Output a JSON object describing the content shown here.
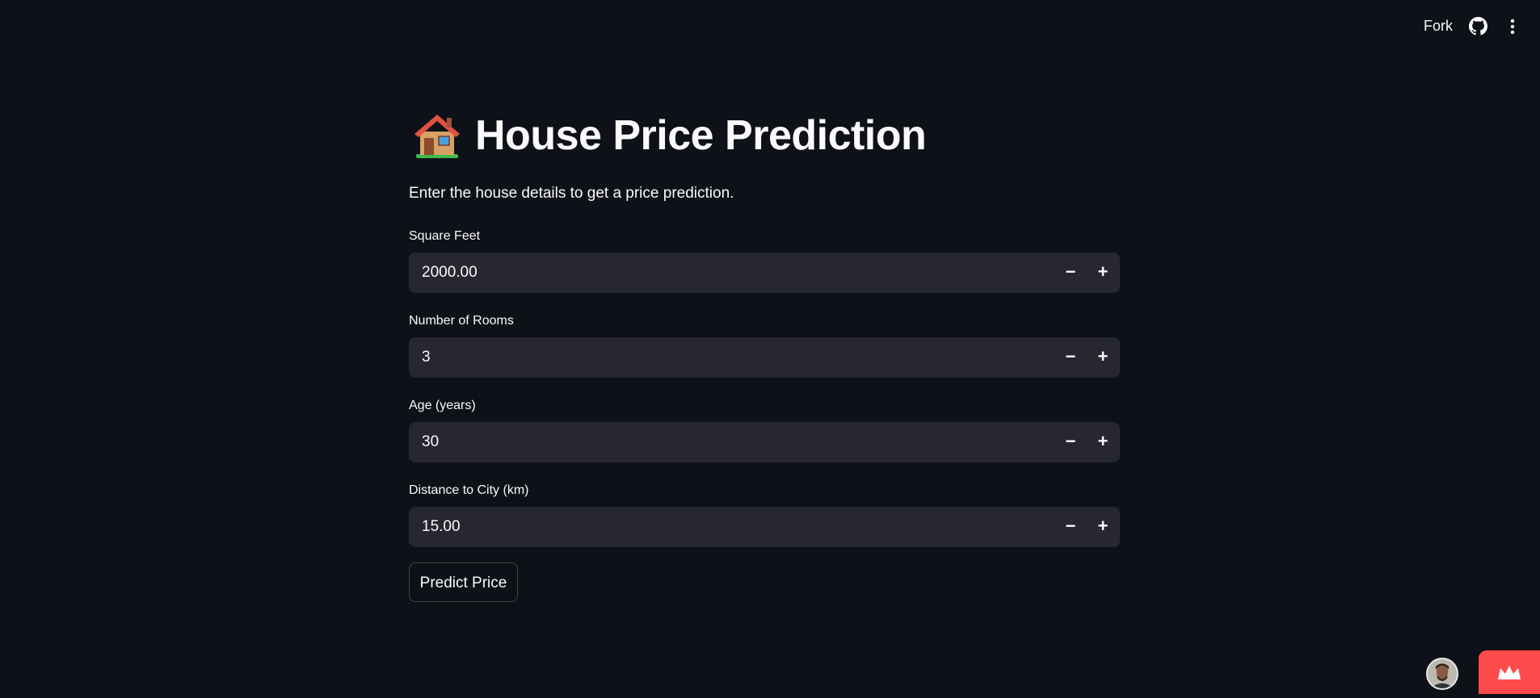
{
  "header": {
    "fork_label": "Fork",
    "icons": [
      "github-icon",
      "more-vertical-icon"
    ]
  },
  "main": {
    "title_icon": "house-icon",
    "title": "House Price Prediction",
    "subtitle": "Enter the house details to get a price prediction.",
    "fields": [
      {
        "label": "Square Feet",
        "value": "2000.00"
      },
      {
        "label": "Number of Rooms",
        "value": "3"
      },
      {
        "label": "Age (years)",
        "value": "30"
      },
      {
        "label": "Distance to City (km)",
        "value": "15.00"
      }
    ],
    "stepper": {
      "minus": "−",
      "plus": "+"
    },
    "predict_button": "Predict Price"
  },
  "footer": {
    "avatar_icon": "user-avatar",
    "badge_icon": "crown-icon",
    "badge_color": "#ff4b4b"
  },
  "colors": {
    "background": "#0e1117",
    "input_background": "#262730",
    "text": "#fafafa"
  }
}
